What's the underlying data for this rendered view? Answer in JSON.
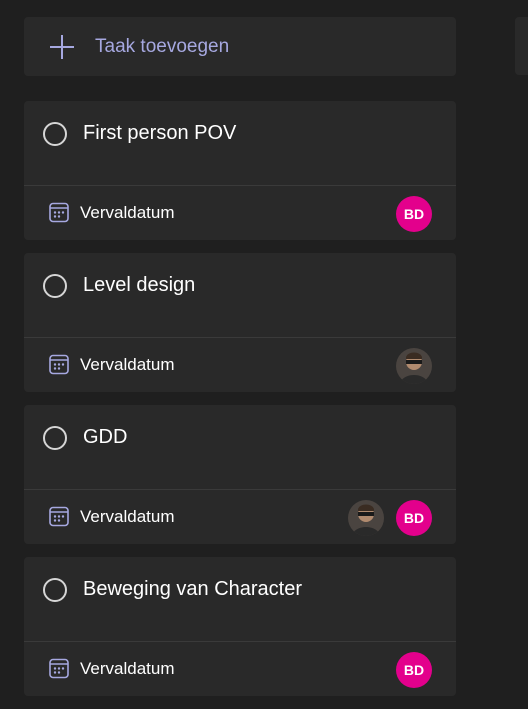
{
  "add_task": {
    "label": "Taak toevoegen"
  },
  "due_label": "Vervaldatum",
  "cards": [
    {
      "title": "First person POV",
      "assignees": [
        {
          "type": "initials",
          "initials": "BD",
          "color": "#e3008c"
        }
      ]
    },
    {
      "title": "Level design",
      "assignees": [
        {
          "type": "photo"
        }
      ]
    },
    {
      "title": "GDD",
      "assignees": [
        {
          "type": "photo"
        },
        {
          "type": "initials",
          "initials": "BD",
          "color": "#e3008c"
        }
      ]
    },
    {
      "title": "Beweging van Character",
      "assignees": [
        {
          "type": "initials",
          "initials": "BD",
          "color": "#e3008c"
        }
      ]
    }
  ],
  "colors": {
    "background": "#1f1f1f",
    "card": "#292929",
    "accent": "#a6a8e0",
    "avatar_bg": "#e3008c"
  },
  "icons": [
    "plus-icon",
    "circle-checkbox-icon",
    "calendar-icon"
  ]
}
